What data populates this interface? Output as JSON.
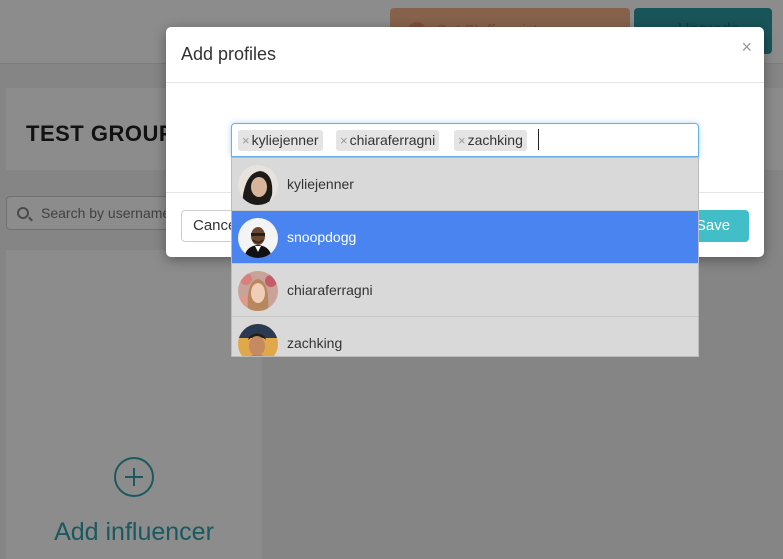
{
  "background": {
    "top_button_1_label": "Get Staff assistance",
    "top_button_2_label": "Upgrade",
    "group_title": "TEST GROUP",
    "search_placeholder": "Search by username",
    "add_influencer_label": "Add influencer"
  },
  "modal": {
    "title": "Add profiles",
    "close_symbol": "×",
    "cancel_label": "Cancel",
    "save_label": "Save"
  },
  "tags": [
    {
      "remove_symbol": "×",
      "label": "kyliejenner"
    },
    {
      "remove_symbol": "×",
      "label": "chiaraferragni"
    },
    {
      "remove_symbol": "×",
      "label": "zachking"
    }
  ],
  "suggestions": [
    {
      "username": "kyliejenner",
      "active": false
    },
    {
      "username": "snoopdogg",
      "active": true
    },
    {
      "username": "chiaraferragni",
      "active": false
    },
    {
      "username": "zachking",
      "active": false
    }
  ],
  "colors": {
    "accent": "#42bec8",
    "highlight": "#4a84f1",
    "influencer_teal": "#2fa3ad"
  },
  "icons": {
    "search": "search-icon",
    "close": "close-icon",
    "add": "plus-circle-icon"
  }
}
